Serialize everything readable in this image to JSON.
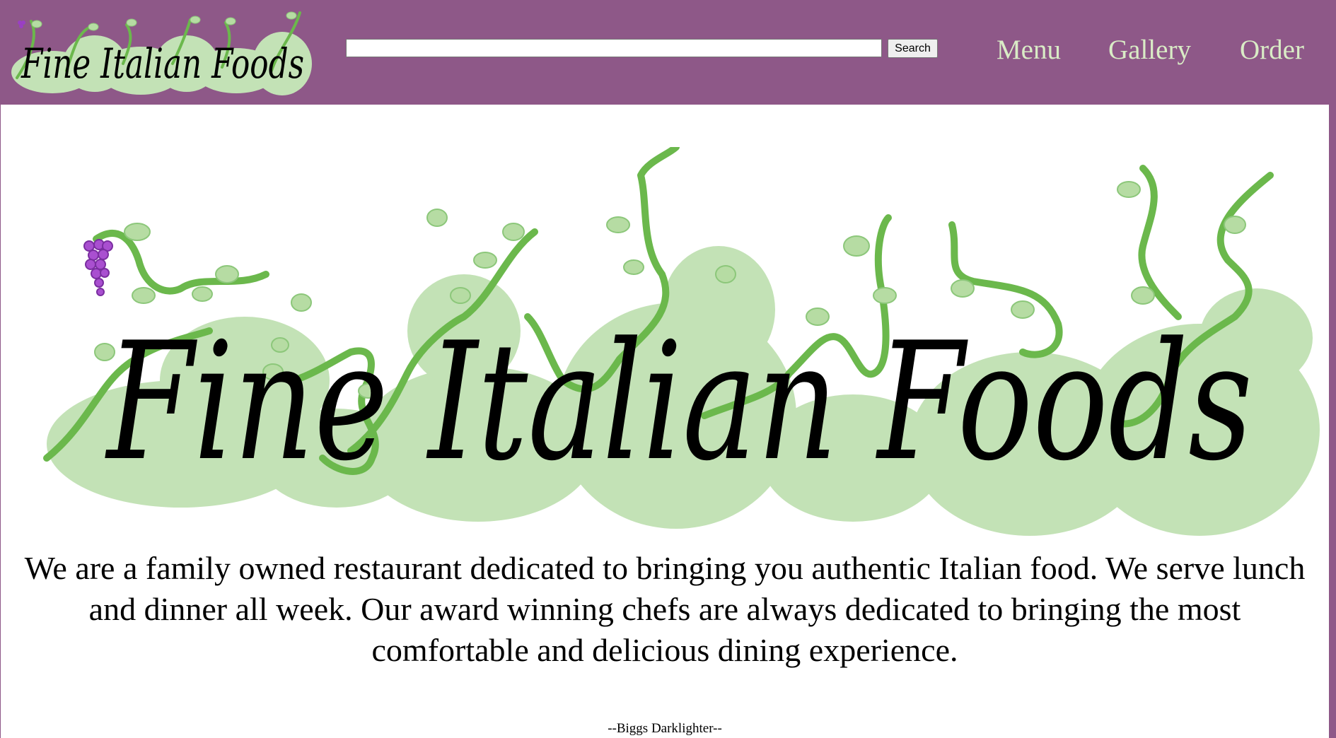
{
  "site": {
    "name": "Fine Italian Foods",
    "logo_word_1": "Fine",
    "logo_word_2": "Italian",
    "logo_word_3": "Foods"
  },
  "header": {
    "search": {
      "value": "",
      "placeholder": "",
      "button_label": "Search"
    },
    "nav": [
      {
        "label": "Menu"
      },
      {
        "label": "Gallery"
      },
      {
        "label": "Order"
      }
    ]
  },
  "main": {
    "intro_text": "We are a family owned restaurant dedicated to bringing you authentic Italian food. We serve lunch and dinner all week. Our award winning chefs are always dedicated to bringing the most comfortable and delicious dining experience.",
    "quote_text": "--Biggs Darklighter--"
  },
  "colors": {
    "header_bg": "#8e5888",
    "nav_text": "#d9ecc6",
    "vine": "#6bb84c",
    "blob": "#c3e2b6",
    "grape": "#9a3fc4",
    "leaf": "#b6dca3"
  },
  "icons": {
    "grape": "grape-icon",
    "leaf": "leaf-icon"
  }
}
